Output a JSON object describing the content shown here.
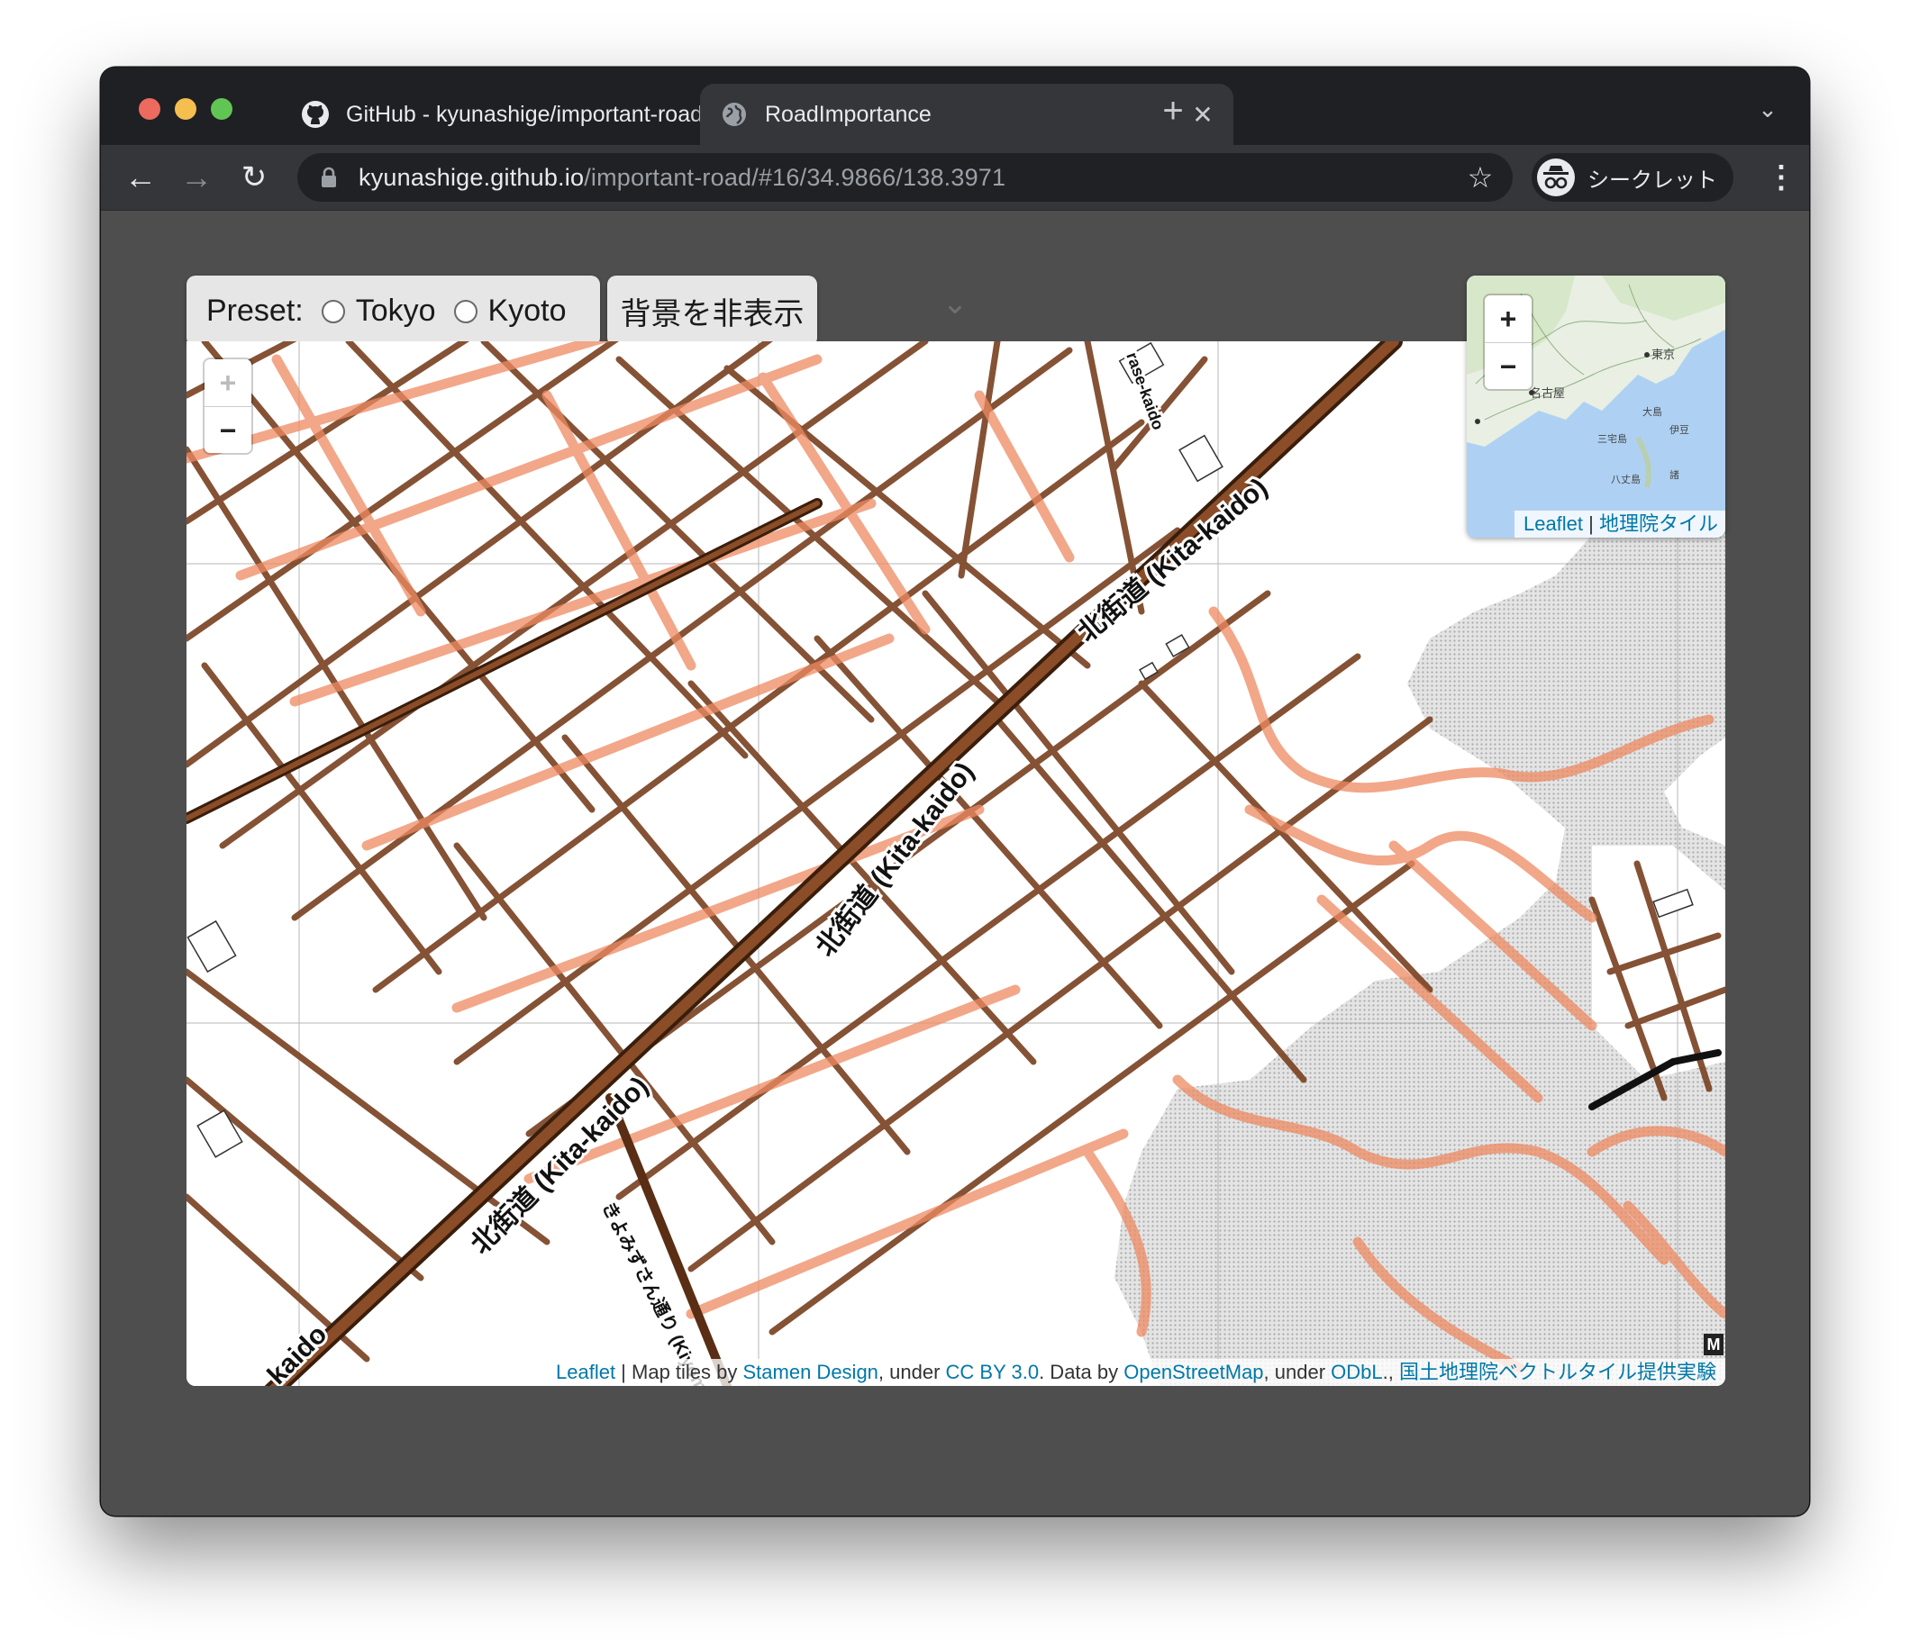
{
  "browser": {
    "tabs": [
      {
        "title": "GitHub - kyunashige/important-road",
        "favicon": "github-icon"
      },
      {
        "title": "RoadImportance",
        "favicon": "globe-icon"
      }
    ],
    "url_host": "kyunashige.github.io",
    "url_path": "/important-road/#16/34.9866/138.3971",
    "incognito_label": "シークレット"
  },
  "controls": {
    "preset_label": "Preset:",
    "preset_options": [
      "Tokyo",
      "Kyoto"
    ],
    "toggle_background_label": "背景を非表示"
  },
  "map": {
    "zoom_in": "+",
    "zoom_out": "−",
    "road_labels": [
      "北街道 (Kita-kaido)",
      "北街道 (Kita-kaido)",
      "北街道 (Kita-kaido)",
      "きよみずさん通り (Kiyomi",
      "kaido",
      "rase-kaido"
    ],
    "attribution": {
      "leaflet": "Leaflet",
      "sep": " | Map tiles by ",
      "stamen": "Stamen Design",
      "under1": ", under ",
      "ccby": "CC BY 3.0",
      "data_by": ". Data by ",
      "osm": "OpenStreetMap",
      "under2": ", under ",
      "odbl": "ODbL",
      "comma": "., ",
      "gsi": "国土地理院ベクトルタイル提供実験"
    },
    "corner_badge": "M",
    "colors": {
      "road_major": "#6b3a1f",
      "road_importance": "#ef8a62",
      "water": "#d4d4d4"
    }
  },
  "minimap": {
    "zoom_in": "+",
    "zoom_out": "−",
    "place_labels": [
      "名古屋",
      "東京",
      "大島",
      "三宅島",
      "伊豆",
      "八丈島",
      "諸"
    ],
    "attribution_leaflet": "Leaflet",
    "attribution_sep": " | ",
    "attribution_gsi": "地理院タイル"
  }
}
